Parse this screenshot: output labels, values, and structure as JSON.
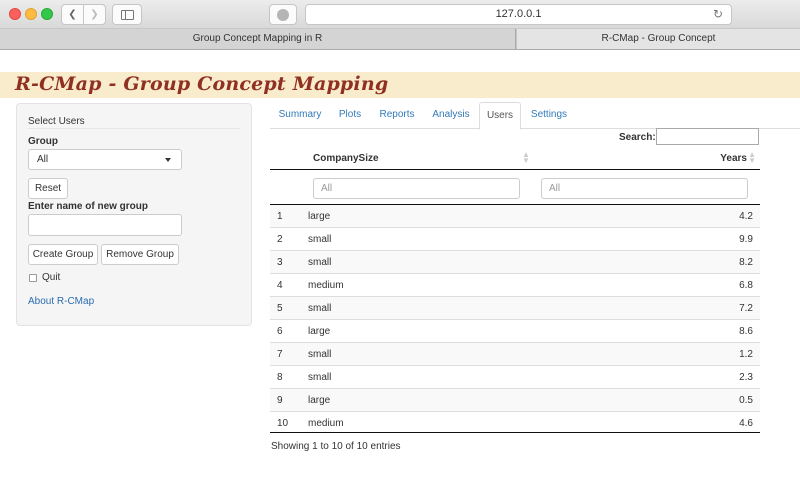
{
  "browser": {
    "url": "127.0.0.1",
    "tabs": [
      {
        "label": "Group Concept Mapping in R"
      },
      {
        "label": "R-CMap - Group Concept"
      }
    ]
  },
  "app": {
    "title": "R-CMap - Group Concept Mapping"
  },
  "sidebar": {
    "section_title": "Select Users",
    "group_label": "Group",
    "group_selected": "All",
    "reset_label": "Reset",
    "new_group_label": "Enter name of new group",
    "new_group_value": "",
    "create_label": "Create Group",
    "remove_label": "Remove Group",
    "quit_label": "Quit",
    "about_label": "About R-CMap"
  },
  "tabs": [
    {
      "label": "Summary"
    },
    {
      "label": "Plots"
    },
    {
      "label": "Reports"
    },
    {
      "label": "Analysis"
    },
    {
      "label": "Users"
    },
    {
      "label": "Settings"
    }
  ],
  "active_tab": "Users",
  "table": {
    "search_label": "Search:",
    "search_value": "",
    "columns": [
      "",
      "CompanySize",
      "Years"
    ],
    "filter_placeholders": [
      "All",
      "All"
    ],
    "rows": [
      [
        "1",
        "large",
        "4.2"
      ],
      [
        "2",
        "small",
        "9.9"
      ],
      [
        "3",
        "small",
        "8.2"
      ],
      [
        "4",
        "medium",
        "6.8"
      ],
      [
        "5",
        "small",
        "7.2"
      ],
      [
        "6",
        "large",
        "8.6"
      ],
      [
        "7",
        "small",
        "1.2"
      ],
      [
        "8",
        "small",
        "2.3"
      ],
      [
        "9",
        "large",
        "0.5"
      ],
      [
        "10",
        "medium",
        "4.6"
      ]
    ],
    "info": "Showing 1 to 10 of 10 entries"
  }
}
